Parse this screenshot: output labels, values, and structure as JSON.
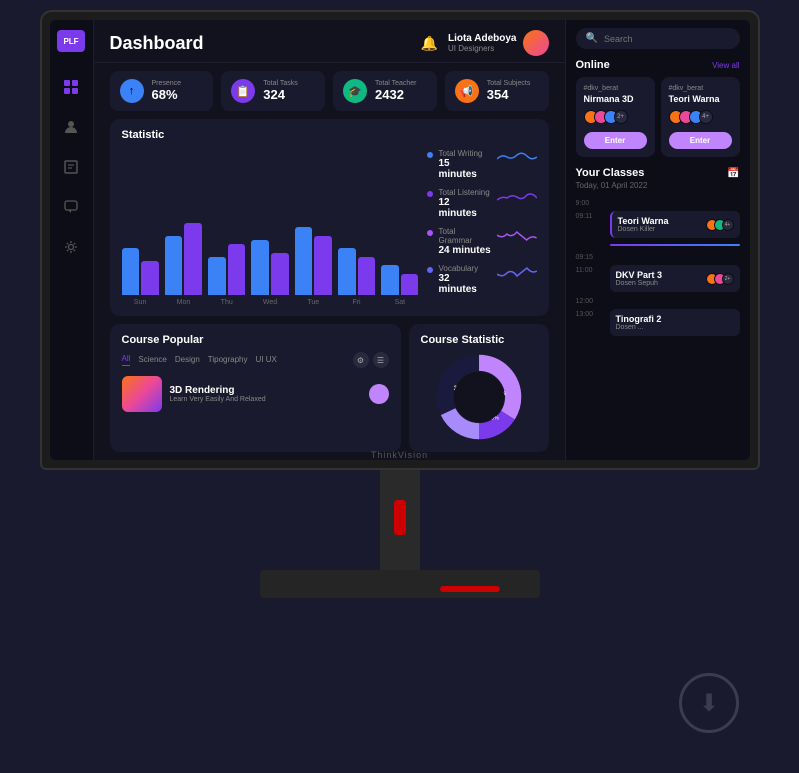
{
  "monitor": {
    "brand": "ThinkVision"
  },
  "app": {
    "title": "Dashboard"
  },
  "sidebar": {
    "logo": "PLF",
    "items": [
      {
        "id": "grid",
        "icon": "⊞",
        "active": true
      },
      {
        "id": "user",
        "icon": "👤",
        "active": false
      },
      {
        "id": "book",
        "icon": "📖",
        "active": false
      },
      {
        "id": "chat",
        "icon": "💬",
        "active": false
      },
      {
        "id": "settings",
        "icon": "⚙",
        "active": false
      }
    ]
  },
  "header": {
    "title": "Dashboard",
    "user": {
      "name": "Liota Adeboya",
      "role": "UI Designers"
    }
  },
  "stats": [
    {
      "id": "presence",
      "label": "Presence",
      "value": "68%",
      "icon": "↑",
      "color": "blue"
    },
    {
      "id": "tasks",
      "label": "Total Tasks",
      "value": "324",
      "icon": "📋",
      "color": "purple"
    },
    {
      "id": "teacher",
      "label": "Total Teacher",
      "value": "2432",
      "icon": "🎓",
      "color": "green"
    },
    {
      "id": "subjects",
      "label": "Total Subjects",
      "value": "354",
      "icon": "📢",
      "color": "orange"
    }
  ],
  "chart": {
    "title": "Statistic",
    "days": [
      "Sun",
      "Mon",
      "Thu",
      "Wed",
      "Tue",
      "Fri",
      "Sat"
    ],
    "bars": [
      {
        "blue": 55,
        "purple": 40
      },
      {
        "blue": 70,
        "purple": 85
      },
      {
        "blue": 45,
        "purple": 60
      },
      {
        "blue": 65,
        "purple": 50
      },
      {
        "blue": 80,
        "purple": 70
      },
      {
        "blue": 55,
        "purple": 45
      },
      {
        "blue": 35,
        "purple": 25
      }
    ],
    "legend": [
      {
        "label": "Total Writing",
        "value": "15 minutes",
        "color": "#3b82f6"
      },
      {
        "label": "Total Listening",
        "value": "12 minutes",
        "color": "#7c3aed"
      },
      {
        "label": "Total Grammar",
        "value": "24 minutes",
        "color": "#a855f7"
      },
      {
        "label": "Vocabulary",
        "value": "32 minutes",
        "color": "#6366f1"
      }
    ]
  },
  "course_popular": {
    "title": "Course Popular",
    "tabs": [
      "All",
      "Science",
      "Design",
      "Tipography",
      "UI UX"
    ],
    "active_tab": "All",
    "courses": [
      {
        "name": "3D Rendering",
        "description": "Learn Very Easily And Relaxed"
      }
    ]
  },
  "course_statistic": {
    "title": "Course Statistic",
    "segments": [
      {
        "label": "A",
        "value": 34,
        "color": "#c084fc"
      },
      {
        "label": "B",
        "value": 16,
        "color": "#7c3aed"
      },
      {
        "label": "C",
        "value": 18,
        "color": "#a78bfa"
      },
      {
        "label": "D",
        "value": 32,
        "color": "#1a1a3e"
      }
    ]
  },
  "right_panel": {
    "search": {
      "placeholder": "Search"
    },
    "online": {
      "title": "Online",
      "view_all": "View all",
      "cards": [
        {
          "tag": "#dkv_berat",
          "name": "Nirmana 3D",
          "count": "2+",
          "btn": "Enter"
        },
        {
          "tag": "#dkv_berat",
          "name": "Teori Warna",
          "count": "4+",
          "btn": "Enter"
        }
      ]
    },
    "classes": {
      "title": "Your Classes",
      "date": "Today, 01 April 2022",
      "schedule": [
        {
          "time": "9:00",
          "name": null,
          "teacher": null
        },
        {
          "time": "09:11",
          "name": "Teori Warna",
          "teacher": "Dosen Killer",
          "avatars": 3,
          "count": "4+"
        },
        {
          "time": "09:15",
          "progress": true
        },
        {
          "time": "11:00",
          "name": "DKV Part 3",
          "teacher": "Dosen Sepuh",
          "avatars": 3,
          "count": "2+"
        },
        {
          "time": "12:00",
          "name": null
        },
        {
          "time": "13:00",
          "name": "Tinografi 2",
          "teacher": "...",
          "avatars": 2,
          "count": ""
        }
      ]
    }
  }
}
